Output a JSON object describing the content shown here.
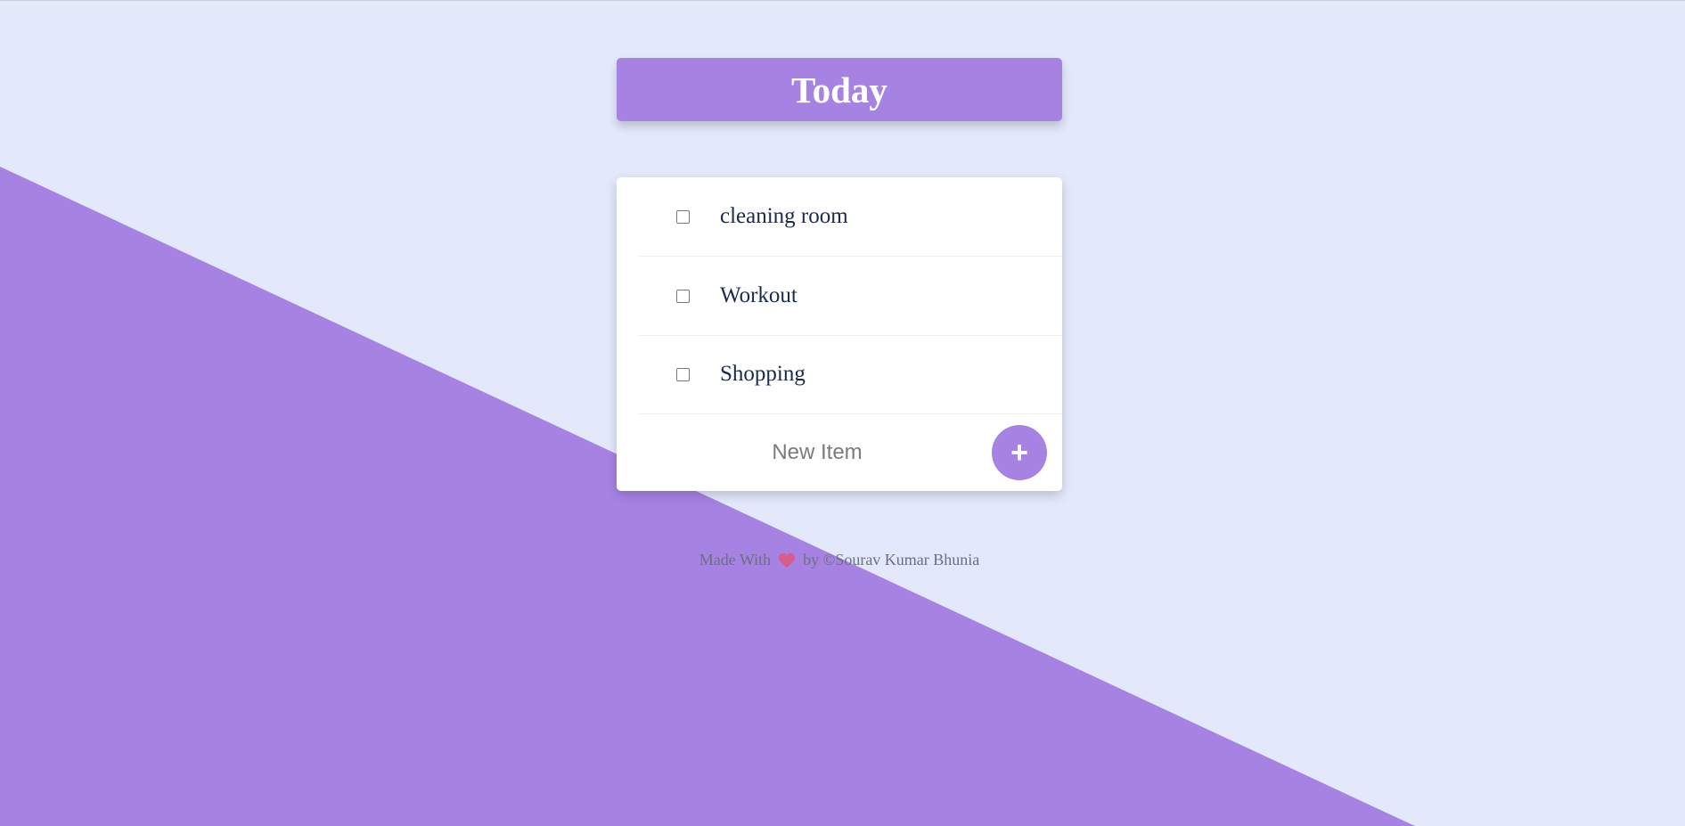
{
  "colors": {
    "background": "#e3e8fb",
    "accent": "#a683e3",
    "card": "#ffffff",
    "item_text": "#1a2a4e",
    "footer_text": "#6b6f80",
    "heart": "#e0567c"
  },
  "header": {
    "title": "Today"
  },
  "list": {
    "items": [
      {
        "label": "cleaning room",
        "checked": false
      },
      {
        "label": "Workout",
        "checked": false
      },
      {
        "label": "Shopping",
        "checked": false
      }
    ]
  },
  "new_item": {
    "placeholder": "New Item",
    "value": "",
    "add_label": "+"
  },
  "footer": {
    "prefix": "Made With",
    "icon": "heart-icon",
    "suffix": "by ©Sourav Kumar Bhunia"
  }
}
